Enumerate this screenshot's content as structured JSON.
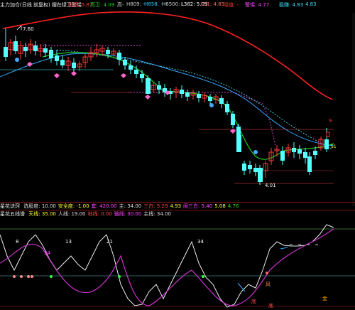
{
  "header": {
    "title": "主力加仓(日线 前复权) 摆在绿卫警惕",
    "labels": [
      {
        "text": "前高: 5.87",
        "color": "#ff3333"
      },
      {
        "text": "高卫: 4.09",
        "color": "#22cc22"
      },
      {
        "text": "高-",
        "color": "#cccccc"
      },
      {
        "text": "H809: -",
        "color": "#cccccc"
      },
      {
        "text": "H858: -",
        "color": "#33ccff"
      },
      {
        "text": "H6500: -",
        "color": "#cccccc"
      },
      {
        "text": "L382: 5.09",
        "color": "#ffffff"
      },
      {
        "text": "L51: 4.85",
        "color": "#ff6666"
      },
      {
        "text": "阻值: -",
        "color": "#ff3333"
      },
      {
        "text": "警惕: 4.77",
        "color": "#ff44ff"
      },
      {
        "text": "稳赚: 4.83",
        "color": "#44ddff"
      },
      {
        "text": "4.83",
        "color": "#44ddff"
      }
    ]
  },
  "main_chart": {
    "price_high_label": "7.60",
    "price_low_label": "4.01",
    "right_label_9": "9",
    "right_label_51": "51",
    "colors": {
      "up_candle": "#ff3b3b",
      "down_candle": "#55ffff",
      "ma_long": "#ff2020",
      "ma_mid": "#22cc22",
      "ma_blue": "#33aaff",
      "dotted_magenta": "#cc44cc",
      "dotted_cyan": "#44ccdd"
    }
  },
  "indicator_bar_1": {
    "name": "星花诀窍",
    "items": [
      {
        "text": "选股度: 10.00",
        "color": "#dddddd"
      },
      {
        "text": "安全度: -1.00",
        "color": "#ffff33"
      },
      {
        "text": "套: 420.00",
        "color": "#ff44ff"
      },
      {
        "text": "主: 34.00",
        "color": "#dddddd"
      },
      {
        "text": "三白: 5.29",
        "color": "#ff4444"
      },
      {
        "text": "4.93",
        "color": "#ffff33"
      },
      {
        "text": "闹三白: 5.40",
        "color": "#ff44ff"
      },
      {
        "text": "5.08",
        "color": "#ffff33"
      },
      {
        "text": "4.76",
        "color": "#22dd22"
      }
    ]
  },
  "indicator_bar_2": {
    "name": "星花五线谱",
    "items": [
      {
        "text": "天线: 35.00",
        "color": "#ffff33"
      },
      {
        "text": "人线: 19.00",
        "color": "#dddddd"
      },
      {
        "text": "地线: 0.00",
        "color": "#ff4444"
      },
      {
        "text": "骗线: 30.00",
        "color": "#ff44ff"
      },
      {
        "text": "主线: 34.00",
        "color": "#dddddd"
      }
    ]
  },
  "lower_chart": {
    "labels": [
      {
        "text": "8"
      },
      {
        "text": "13"
      },
      {
        "text": "21"
      },
      {
        "text": "34"
      },
      {
        "text": "34"
      }
    ],
    "signals": [
      {
        "text": "底"
      },
      {
        "text": "风"
      },
      {
        "text": "金"
      },
      {
        "text": "底"
      }
    ]
  }
}
